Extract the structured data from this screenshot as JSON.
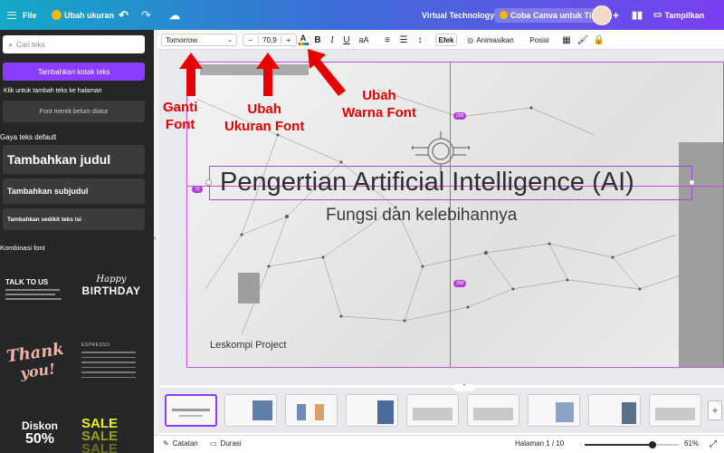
{
  "topbar": {
    "menu_icon": "hamburger-icon",
    "file_label": "File",
    "resize_label": "Ubah ukuran",
    "doc_title": "Virtual Technology",
    "trial_label": "Coba Canva untuk Tim",
    "share_label": "Tampilkan",
    "colors": {
      "gradient_start": "#13a9c7",
      "gradient_end": "#7a3ff0"
    }
  },
  "sidebar": {
    "search_placeholder": "Cari teks",
    "add_textbox": "Tambahkan kotak teks",
    "click_hint": "Klik untuk tambah teks ke halaman",
    "brand_font_label": "Font merek belum diatur",
    "default_styles_heading": "Gaya teks default",
    "heading_label": "Tambahkan judul",
    "subheading_label": "Tambahkan subjudul",
    "body_label": "Tambahkan sedikit teks isi",
    "font_combos_heading": "Kombinasi font",
    "combos": {
      "talk": "TALK TO US",
      "happy": "Happy",
      "birthday": "BIRTHDAY",
      "thank": "Thank",
      "you": "you!",
      "espresso": "ESPRESSO",
      "diskon": "Diskon",
      "diskon_pct": "50%",
      "sale": "SALE"
    }
  },
  "propbar": {
    "font_name": "Tomorrow",
    "font_size": "70,9",
    "minus": "−",
    "plus": "+",
    "text_color_letter": "A",
    "bold": "B",
    "italic": "I",
    "underline": "U",
    "case": "aA",
    "effects": "Efek",
    "animate": "Animasikan",
    "position": "Posisi"
  },
  "slide": {
    "title": "Pengertian Artificial Intelligence (AI)",
    "subtitle": "Fungsi dan kelebihannya",
    "footer": "Leskompi Project",
    "pill_top": "258",
    "pill_left": "70",
    "pill_bottom": "258"
  },
  "annotations": {
    "font": [
      "Ganti",
      "Font"
    ],
    "size": [
      "Ubah",
      "Ukuran Font"
    ],
    "color": [
      "Ubah",
      "Warna Font"
    ],
    "color_hex": "#e60000"
  },
  "bottombar": {
    "notes": "Catatan",
    "duration": "Durasi",
    "page": "Halaman 1 / 10",
    "zoom": "61%",
    "zoom_fraction": 0.61
  }
}
